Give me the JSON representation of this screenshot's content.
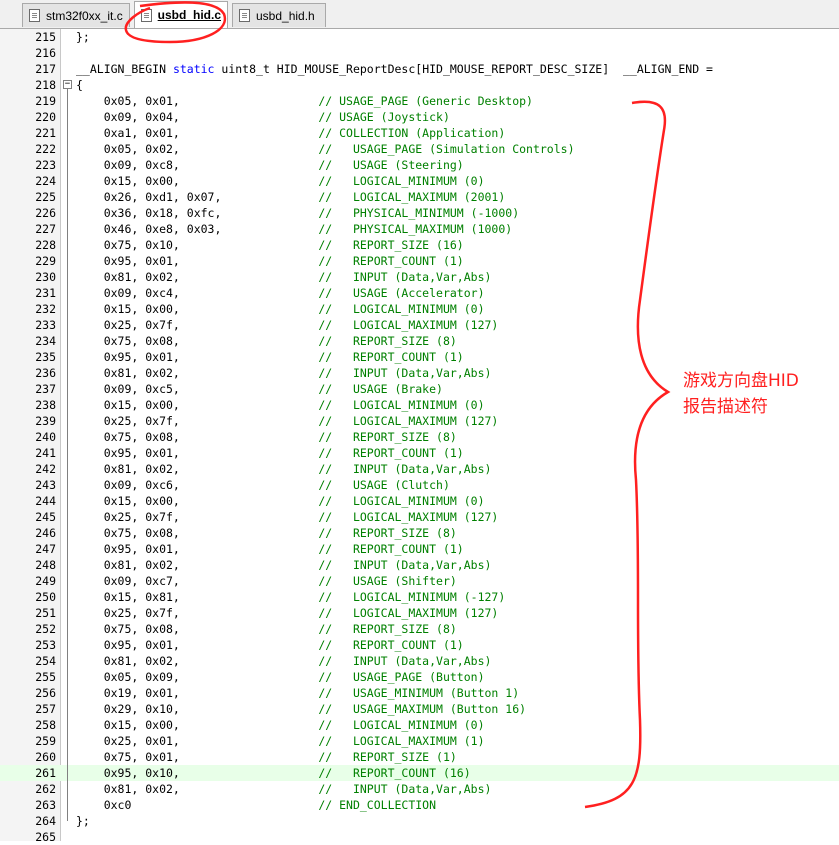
{
  "tabs": [
    {
      "label": "stm32f0xx_it.c",
      "active": false
    },
    {
      "label": "usbd_hid.c",
      "active": true
    },
    {
      "label": "usbd_hid.h",
      "active": false
    }
  ],
  "annotation": {
    "line1": "游戏方向盘HID",
    "line2": "报告描述符"
  },
  "highlight_line": "261",
  "lines": [
    {
      "n": "215",
      "code": "};",
      "cmt": ""
    },
    {
      "n": "216",
      "code": "",
      "cmt": ""
    },
    {
      "n": "217",
      "code": "__ALIGN_BEGIN static uint8_t HID_MOUSE_ReportDesc[HID_MOUSE_REPORT_DESC_SIZE]  __ALIGN_END =",
      "cmt": ""
    },
    {
      "n": "218",
      "code": "{",
      "cmt": ""
    },
    {
      "n": "219",
      "code": "    0x05, 0x01,                    ",
      "cmt": "// USAGE_PAGE (Generic Desktop)"
    },
    {
      "n": "220",
      "code": "    0x09, 0x04,                    ",
      "cmt": "// USAGE (Joystick)"
    },
    {
      "n": "221",
      "code": "    0xa1, 0x01,                    ",
      "cmt": "// COLLECTION (Application)"
    },
    {
      "n": "222",
      "code": "    0x05, 0x02,                    ",
      "cmt": "//   USAGE_PAGE (Simulation Controls)"
    },
    {
      "n": "223",
      "code": "    0x09, 0xc8,                    ",
      "cmt": "//   USAGE (Steering)"
    },
    {
      "n": "224",
      "code": "    0x15, 0x00,                    ",
      "cmt": "//   LOGICAL_MINIMUM (0)"
    },
    {
      "n": "225",
      "code": "    0x26, 0xd1, 0x07,              ",
      "cmt": "//   LOGICAL_MAXIMUM (2001)"
    },
    {
      "n": "226",
      "code": "    0x36, 0x18, 0xfc,              ",
      "cmt": "//   PHYSICAL_MINIMUM (-1000)"
    },
    {
      "n": "227",
      "code": "    0x46, 0xe8, 0x03,              ",
      "cmt": "//   PHYSICAL_MAXIMUM (1000)"
    },
    {
      "n": "228",
      "code": "    0x75, 0x10,                    ",
      "cmt": "//   REPORT_SIZE (16)"
    },
    {
      "n": "229",
      "code": "    0x95, 0x01,                    ",
      "cmt": "//   REPORT_COUNT (1)"
    },
    {
      "n": "230",
      "code": "    0x81, 0x02,                    ",
      "cmt": "//   INPUT (Data,Var,Abs)"
    },
    {
      "n": "231",
      "code": "    0x09, 0xc4,                    ",
      "cmt": "//   USAGE (Accelerator)"
    },
    {
      "n": "232",
      "code": "    0x15, 0x00,                    ",
      "cmt": "//   LOGICAL_MINIMUM (0)"
    },
    {
      "n": "233",
      "code": "    0x25, 0x7f,                    ",
      "cmt": "//   LOGICAL_MAXIMUM (127)"
    },
    {
      "n": "234",
      "code": "    0x75, 0x08,                    ",
      "cmt": "//   REPORT_SIZE (8)"
    },
    {
      "n": "235",
      "code": "    0x95, 0x01,                    ",
      "cmt": "//   REPORT_COUNT (1)"
    },
    {
      "n": "236",
      "code": "    0x81, 0x02,                    ",
      "cmt": "//   INPUT (Data,Var,Abs)"
    },
    {
      "n": "237",
      "code": "    0x09, 0xc5,                    ",
      "cmt": "//   USAGE (Brake)"
    },
    {
      "n": "238",
      "code": "    0x15, 0x00,                    ",
      "cmt": "//   LOGICAL_MINIMUM (0)"
    },
    {
      "n": "239",
      "code": "    0x25, 0x7f,                    ",
      "cmt": "//   LOGICAL_MAXIMUM (127)"
    },
    {
      "n": "240",
      "code": "    0x75, 0x08,                    ",
      "cmt": "//   REPORT_SIZE (8)"
    },
    {
      "n": "241",
      "code": "    0x95, 0x01,                    ",
      "cmt": "//   REPORT_COUNT (1)"
    },
    {
      "n": "242",
      "code": "    0x81, 0x02,                    ",
      "cmt": "//   INPUT (Data,Var,Abs)"
    },
    {
      "n": "243",
      "code": "    0x09, 0xc6,                    ",
      "cmt": "//   USAGE (Clutch)"
    },
    {
      "n": "244",
      "code": "    0x15, 0x00,                    ",
      "cmt": "//   LOGICAL_MINIMUM (0)"
    },
    {
      "n": "245",
      "code": "    0x25, 0x7f,                    ",
      "cmt": "//   LOGICAL_MAXIMUM (127)"
    },
    {
      "n": "246",
      "code": "    0x75, 0x08,                    ",
      "cmt": "//   REPORT_SIZE (8)"
    },
    {
      "n": "247",
      "code": "    0x95, 0x01,                    ",
      "cmt": "//   REPORT_COUNT (1)"
    },
    {
      "n": "248",
      "code": "    0x81, 0x02,                    ",
      "cmt": "//   INPUT (Data,Var,Abs)"
    },
    {
      "n": "249",
      "code": "    0x09, 0xc7,                    ",
      "cmt": "//   USAGE (Shifter)"
    },
    {
      "n": "250",
      "code": "    0x15, 0x81,                    ",
      "cmt": "//   LOGICAL_MINIMUM (-127)"
    },
    {
      "n": "251",
      "code": "    0x25, 0x7f,                    ",
      "cmt": "//   LOGICAL_MAXIMUM (127)"
    },
    {
      "n": "252",
      "code": "    0x75, 0x08,                    ",
      "cmt": "//   REPORT_SIZE (8)"
    },
    {
      "n": "253",
      "code": "    0x95, 0x01,                    ",
      "cmt": "//   REPORT_COUNT (1)"
    },
    {
      "n": "254",
      "code": "    0x81, 0x02,                    ",
      "cmt": "//   INPUT (Data,Var,Abs)"
    },
    {
      "n": "255",
      "code": "    0x05, 0x09,                    ",
      "cmt": "//   USAGE_PAGE (Button)"
    },
    {
      "n": "256",
      "code": "    0x19, 0x01,                    ",
      "cmt": "//   USAGE_MINIMUM (Button 1)"
    },
    {
      "n": "257",
      "code": "    0x29, 0x10,                    ",
      "cmt": "//   USAGE_MAXIMUM (Button 16)"
    },
    {
      "n": "258",
      "code": "    0x15, 0x00,                    ",
      "cmt": "//   LOGICAL_MINIMUM (0)"
    },
    {
      "n": "259",
      "code": "    0x25, 0x01,                    ",
      "cmt": "//   LOGICAL_MAXIMUM (1)"
    },
    {
      "n": "260",
      "code": "    0x75, 0x01,                    ",
      "cmt": "//   REPORT_SIZE (1)"
    },
    {
      "n": "261",
      "code": "    0x95, 0x10,                    ",
      "cmt": "//   REPORT_COUNT (16)"
    },
    {
      "n": "262",
      "code": "    0x81, 0x02,                    ",
      "cmt": "//   INPUT (Data,Var,Abs)"
    },
    {
      "n": "263",
      "code": "    0xc0                           ",
      "cmt": "// END_COLLECTION"
    },
    {
      "n": "264",
      "code": "};",
      "cmt": ""
    },
    {
      "n": "265",
      "code": "",
      "cmt": ""
    }
  ]
}
